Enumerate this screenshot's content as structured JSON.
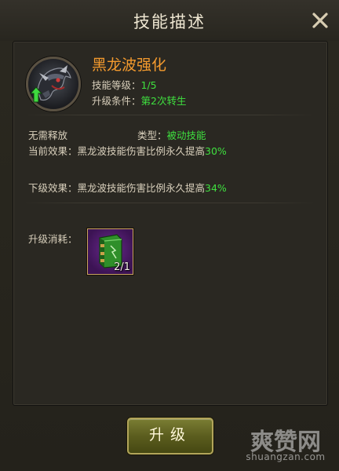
{
  "dialog": {
    "title": "技能描述",
    "close_icon": "close-icon"
  },
  "skill": {
    "icon": "dragon-skill-icon",
    "upgrade_arrow_icon": "green-up-arrow-icon",
    "name": "黑龙波强化",
    "level_label": "技能等级：",
    "level_value": "1/5",
    "condition_label": "升级条件：",
    "condition_value": "第2次转生"
  },
  "details": {
    "release": "无需释放",
    "type_label": "类型：",
    "type_value": "被动技能",
    "current_label": "当前效果：",
    "current_text": "黑龙波技能伤害比例永久提高",
    "current_value": "30%",
    "next_label": "下级效果：",
    "next_text": "黑龙波技能伤害比例永久提高",
    "next_value": "34%"
  },
  "cost": {
    "label": "升级消耗：",
    "item_icon": "skill-book-icon",
    "count": "2/1"
  },
  "buttons": {
    "upgrade_label": "升级"
  },
  "watermark": {
    "text": "爽赞网",
    "url": "shuangzan.com"
  },
  "colors": {
    "skill_name": "#f39a2e",
    "value_green": "#3fe03f",
    "item_bg": "#5a1f7a"
  }
}
